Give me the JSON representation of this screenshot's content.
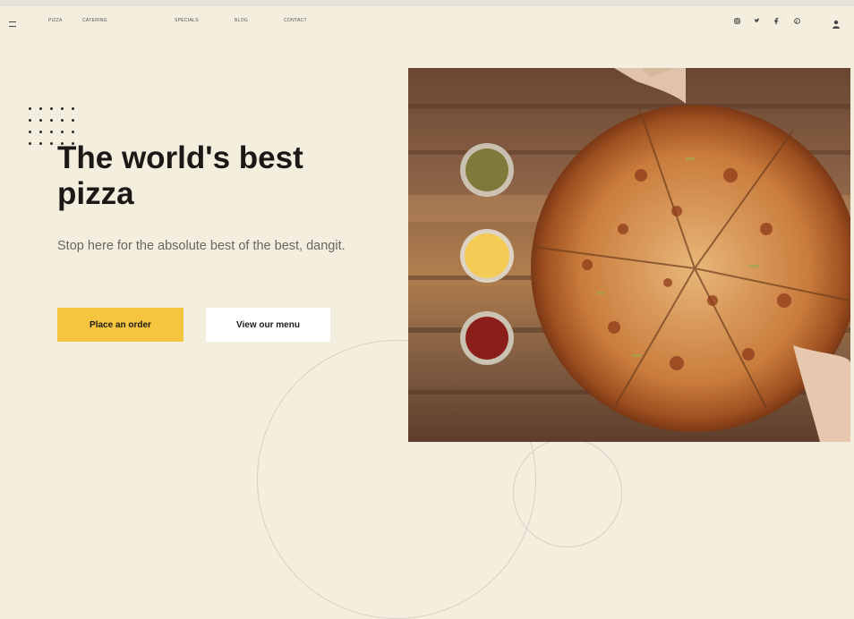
{
  "nav": {
    "menu_icon": "hamburger-icon",
    "links": [
      "Pizza",
      "Catering",
      "Specials",
      "Blog",
      "Contact"
    ],
    "social_icons": [
      "instagram-icon",
      "twitter-icon",
      "facebook-icon",
      "pinterest-icon"
    ],
    "user_icon": "user-icon"
  },
  "hero": {
    "title": "The world's best pizza",
    "subtitle": "Stop here for the absolute best of the best, dangit.",
    "order_button": "Place an order",
    "menu_button": "View our menu"
  },
  "image": {
    "subject": "pizza-on-wooden-board",
    "dips": [
      "pesto",
      "cheese",
      "marinara"
    ]
  },
  "colors": {
    "background": "#f3eede",
    "accent": "#f5c540",
    "text": "#1a1915",
    "muted": "#6a675f"
  }
}
